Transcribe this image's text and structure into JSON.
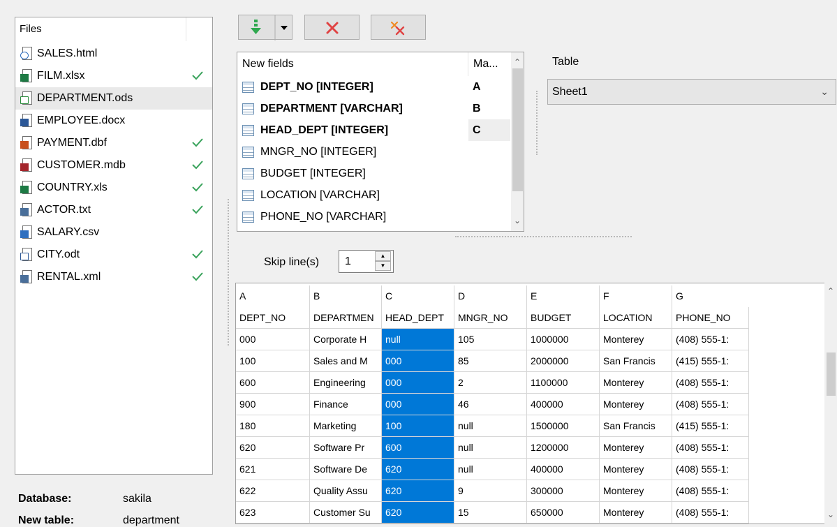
{
  "files": {
    "header": "Files",
    "items": [
      {
        "name": "SALES.html",
        "icon": "html-globe-icon",
        "color": "#2f6fbf",
        "badge": "",
        "checked": false,
        "selected": false
      },
      {
        "name": "FILM.xlsx",
        "icon": "excel-file-icon",
        "color": "#1d7a44",
        "badge": "X",
        "checked": true,
        "selected": false
      },
      {
        "name": "DEPARTMENT.ods",
        "icon": "ods-spreadsheet-icon",
        "color": "#2a8c3c",
        "badge": "",
        "checked": false,
        "selected": true
      },
      {
        "name": "EMPLOYEE.docx",
        "icon": "word-file-icon",
        "color": "#2b5797",
        "badge": "W",
        "checked": false,
        "selected": false
      },
      {
        "name": "PAYMENT.dbf",
        "icon": "dbf-file-icon",
        "color": "#c8501e",
        "badge": "DBF",
        "checked": true,
        "selected": false
      },
      {
        "name": "CUSTOMER.mdb",
        "icon": "access-file-icon",
        "color": "#a4262c",
        "badge": "A",
        "checked": true,
        "selected": false
      },
      {
        "name": "COUNTRY.xls",
        "icon": "excel-file-icon",
        "color": "#1d7a44",
        "badge": "X",
        "checked": true,
        "selected": false
      },
      {
        "name": "ACTOR.txt",
        "icon": "txt-file-icon",
        "color": "#4a6f9a",
        "badge": "TXT",
        "checked": true,
        "selected": false
      },
      {
        "name": "SALARY.csv",
        "icon": "csv-file-icon",
        "color": "#2f6fbf",
        "badge": "a,",
        "checked": false,
        "selected": false
      },
      {
        "name": "CITY.odt",
        "icon": "odt-document-icon",
        "color": "#2b5797",
        "badge": "",
        "checked": true,
        "selected": false
      },
      {
        "name": "RENTAL.xml",
        "icon": "xml-file-icon",
        "color": "#4a6f9a",
        "badge": "XML",
        "checked": true,
        "selected": false
      }
    ]
  },
  "info": {
    "database_label": "Database:",
    "database_value": "sakila",
    "new_table_label": "New table:",
    "new_table_value": "department"
  },
  "toolbar": {
    "buttons": [
      "add-mapping-icon",
      "delete-mapping-icon",
      "clear-all-mappings-icon"
    ],
    "colors": {
      "green": "#2fa84f",
      "red": "#e04343",
      "orange": "#f08a24"
    }
  },
  "fields": {
    "header_name": "New fields",
    "header_map": "Ma...",
    "items": [
      {
        "name": "DEPT_NO  [INTEGER]",
        "map": "A"
      },
      {
        "name": "DEPARTMENT  [VARCHAR]",
        "map": "B"
      },
      {
        "name": "HEAD_DEPT  [INTEGER]",
        "map": "C"
      },
      {
        "name": "MNGR_NO  [INTEGER]",
        "map": ""
      },
      {
        "name": "BUDGET  [INTEGER]",
        "map": ""
      },
      {
        "name": "LOCATION  [VARCHAR]",
        "map": ""
      },
      {
        "name": "PHONE_NO  [VARCHAR]",
        "map": ""
      }
    ]
  },
  "table": {
    "label": "Table",
    "value": "Sheet1"
  },
  "skip": {
    "label": "Skip line(s)",
    "value": "1"
  },
  "grid": {
    "letters": [
      "A",
      "B",
      "C",
      "D",
      "E",
      "F",
      "G"
    ],
    "columns": [
      "DEPT_NO",
      "DEPARTMEN",
      "HEAD_DEPT",
      "MNGR_NO",
      "BUDGET",
      "LOCATION",
      "PHONE_NO"
    ],
    "rows": [
      [
        "000",
        "Corporate H",
        "null",
        "105",
        "1000000",
        "Monterey",
        "(408) 555-1:"
      ],
      [
        "100",
        "Sales and M",
        "000",
        "85",
        "2000000",
        "San Francis",
        "(415) 555-1:"
      ],
      [
        "600",
        "Engineering",
        "000",
        "2",
        "1100000",
        "Monterey",
        "(408) 555-1:"
      ],
      [
        "900",
        "Finance",
        "000",
        "46",
        "400000",
        "Monterey",
        "(408) 555-1:"
      ],
      [
        "180",
        "Marketing",
        "100",
        "null",
        "1500000",
        "San Francis",
        "(415) 555-1:"
      ],
      [
        "620",
        "Software Pr",
        "600",
        "null",
        "1200000",
        "Monterey",
        "(408) 555-1:"
      ],
      [
        "621",
        "Software De",
        "620",
        "null",
        "400000",
        "Monterey",
        "(408) 555-1:"
      ],
      [
        "622",
        "Quality Assu",
        "620",
        "9",
        "300000",
        "Monterey",
        "(408) 555-1:"
      ],
      [
        "623",
        "Customer Su",
        "620",
        "15",
        "650000",
        "Monterey",
        "(408) 555-1:"
      ]
    ],
    "highlight_color": "#0078d7"
  }
}
